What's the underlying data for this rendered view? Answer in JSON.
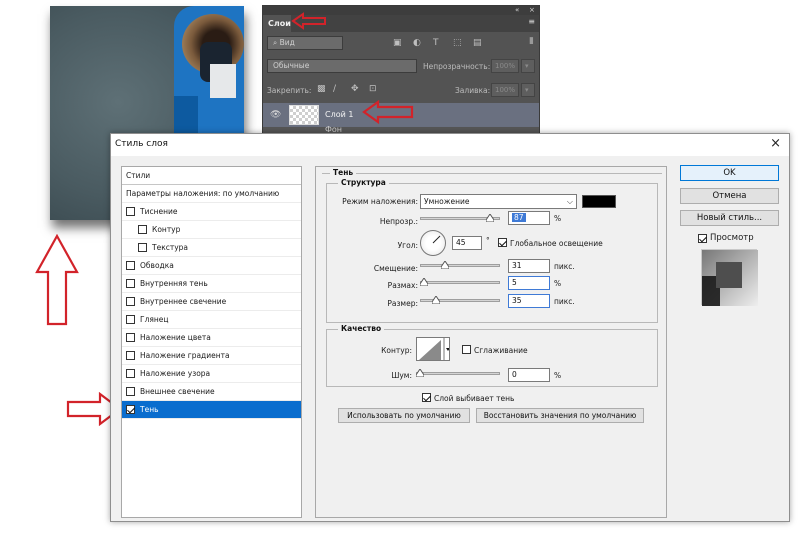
{
  "layers_panel": {
    "tab_label": "Слои",
    "topbar_collapse": "«",
    "topbar_close": "×",
    "menu_icon": "≡",
    "filter_label": "Вид",
    "blend_mode": "Обычные",
    "opacity_label": "Непрозрачность:",
    "opacity_value": "100%",
    "lock_label": "Закрепить:",
    "fill_label": "Заливка:",
    "fill_value": "100%",
    "layer_name": "Слой 1",
    "layer_below_name": "Фон"
  },
  "dialog": {
    "title": "Стиль слоя",
    "close_label": "×",
    "styles_header": "Стили",
    "blend_options_label": "Параметры наложения: по умолчанию",
    "styles": [
      {
        "label": "Тиснение",
        "checked": false,
        "indent": false
      },
      {
        "label": "Контур",
        "checked": false,
        "indent": true
      },
      {
        "label": "Текстура",
        "checked": false,
        "indent": true
      },
      {
        "label": "Обводка",
        "checked": false,
        "indent": false
      },
      {
        "label": "Внутренняя тень",
        "checked": false,
        "indent": false
      },
      {
        "label": "Внутреннее свечение",
        "checked": false,
        "indent": false
      },
      {
        "label": "Глянец",
        "checked": false,
        "indent": false
      },
      {
        "label": "Наложение цвета",
        "checked": false,
        "indent": false
      },
      {
        "label": "Наложение градиента",
        "checked": false,
        "indent": false
      },
      {
        "label": "Наложение узора",
        "checked": false,
        "indent": false
      },
      {
        "label": "Внешнее свечение",
        "checked": false,
        "indent": false
      },
      {
        "label": "Тень",
        "checked": true,
        "indent": false,
        "selected": true
      }
    ],
    "shadow": {
      "group_title": "Тень",
      "structure_title": "Структура",
      "blend_mode_label": "Режим наложения:",
      "blend_mode_value": "Умножение",
      "shadow_color": "#000000",
      "opacity_label": "Непрозр.:",
      "opacity_value": "87",
      "opacity_unit": "%",
      "angle_label": "Угол:",
      "angle_value": "45",
      "angle_unit": "°",
      "global_light_label": "Глобальное освещение",
      "distance_label": "Смещение:",
      "distance_value": "31",
      "distance_unit": "пикс.",
      "spread_label": "Размах:",
      "spread_value": "5",
      "spread_unit": "%",
      "size_label": "Размер:",
      "size_value": "35",
      "size_unit": "пикс.",
      "quality_title": "Качество",
      "contour_label": "Контур:",
      "antialias_label": "Сглаживание",
      "noise_label": "Шум:",
      "noise_value": "0",
      "noise_unit": "%",
      "knockout_label": "Слой выбивает тень",
      "make_default_label": "Использовать по умолчанию",
      "reset_default_label": "Восстановить значения по умолчанию"
    },
    "buttons": {
      "ok": "OK",
      "cancel": "Отмена",
      "new_style": "Новый стиль...",
      "preview_label": "Просмотр"
    }
  },
  "colors": {
    "accent_red": "#d2232a",
    "selection_blue": "#0a6dce"
  }
}
